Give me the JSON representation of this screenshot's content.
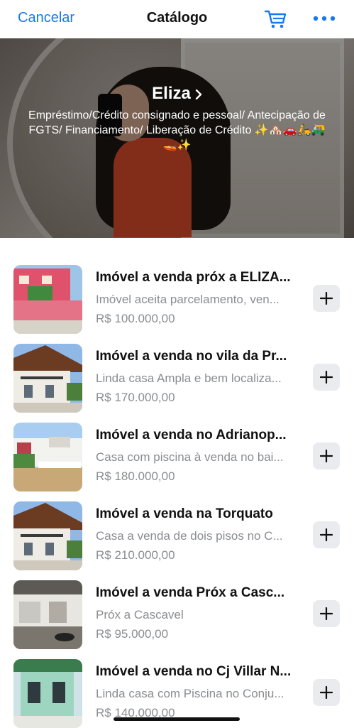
{
  "header": {
    "cancel_label": "Cancelar",
    "title": "Catálogo",
    "cart_icon": "cart-icon",
    "more_icon": "more-icon"
  },
  "profile": {
    "name": "Eliza",
    "bio": "Empréstimo/Crédito consignado e pessoal/ Antecipação de FGTS/ Financiamento/ Liberação de Crédito ✨🏘️🚗🛵🛺🚤✨"
  },
  "listings": [
    {
      "title": "Imóvel a venda próx a ELIZA...",
      "description": "Imóvel aceita parcelamento, ven...",
      "price": "R$ 100.000,00"
    },
    {
      "title": "Imóvel a venda no vila da Pr...",
      "description": "Linda casa Ampla e bem localiza...",
      "price": "R$ 170.000,00"
    },
    {
      "title": "Imóvel a venda no Adrianop...",
      "description": "Casa com piscina à venda no bai...",
      "price": "R$ 180.000,00"
    },
    {
      "title": "Imóvel a venda na Torquato",
      "description": "Casa a venda de dois pisos no C...",
      "price": "R$ 210.000,00"
    },
    {
      "title": "Imóvel a venda Próx a Casc...",
      "description": "Próx a Cascavel",
      "price": "R$ 95.000,00"
    },
    {
      "title": "Imóvel a venda no Cj Villar N...",
      "description": "Linda casa com Piscina no Conju...",
      "price": "R$ 140.000,00"
    }
  ],
  "colors": {
    "accent": "#1877f2",
    "secondary_text": "#8a8d91",
    "add_button_bg": "#e9ebee"
  }
}
